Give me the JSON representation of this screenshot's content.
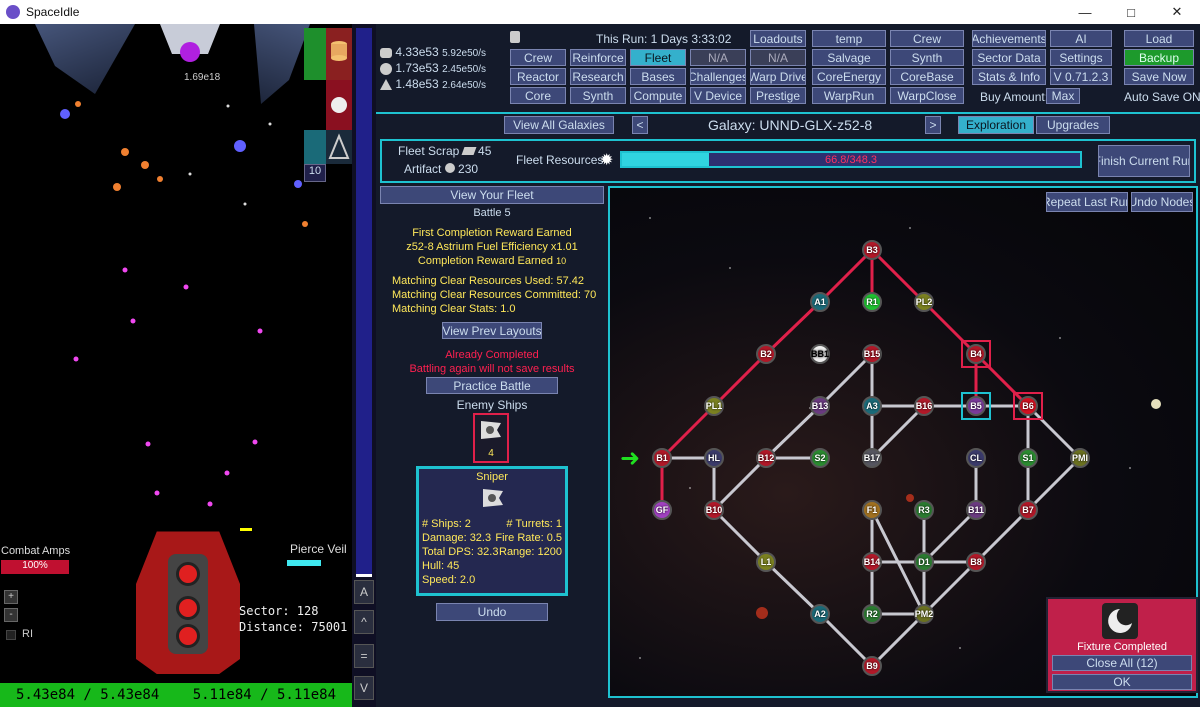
{
  "window": {
    "title": "SpaceIdle"
  },
  "game": {
    "hud_value": "1.69e18",
    "combat_amps_label": "Combat Amps",
    "combat_amps_value": "100%",
    "pierce_veil": "Pierce Veil",
    "sector": "Sector: 128",
    "distance": "Distance: 75001",
    "sidebar_count": "10",
    "hp_left": "5.43e84 / 5.43e84",
    "hp_right": "5.11e84 / 5.11e84",
    "plus": "+",
    "minus": "-",
    "ri": "RI"
  },
  "scroll": {
    "a": "A",
    "up": "^",
    "eq": "=",
    "down": "V"
  },
  "resources": [
    {
      "amount": "4.33e53",
      "rate": "5.92e50/s"
    },
    {
      "amount": "1.73e53",
      "rate": "2.45e50/s"
    },
    {
      "amount": "1.48e53",
      "rate": "2.64e50/s"
    }
  ],
  "this_run": "This Run: 1 Days 3:33:02",
  "nav": {
    "crew": "Crew",
    "reinforce": "Reinforce",
    "fleet": "Fleet",
    "na1": "N/A",
    "loadouts": "Loadouts",
    "temp": "temp",
    "crew2": "Crew",
    "achievements": "Achievements",
    "ai": "AI",
    "load": "Load",
    "reactor": "Reactor",
    "research": "Research",
    "bases": "Bases",
    "challenges": "Challenges",
    "na2": "N/A",
    "salvage": "Salvage",
    "synth2": "Synth",
    "sector_data": "Sector Data",
    "settings": "Settings",
    "backup": "Backup",
    "core": "Core",
    "synth": "Synth",
    "compute": "Compute",
    "vdevice": "V Device",
    "warpdrive": "Warp Drive",
    "coreenergy": "CoreEnergy",
    "corebase": "CoreBase",
    "stats": "Stats & Info",
    "version": "V 0.71.2.3",
    "savenow": "Save Now",
    "prestige": "Prestige",
    "warprun": "WarpRun",
    "warpclose": "WarpClose",
    "buy_amount": "Buy Amount:",
    "max": "Max",
    "autosave": "Auto Save ON"
  },
  "galaxy": {
    "view_all": "View All Galaxies",
    "prev": "<",
    "next": ">",
    "name": "Galaxy: UNND-GLX-z52-8",
    "exploration": "Exploration",
    "upgrades": "Upgrades"
  },
  "fleet": {
    "scrap_label": "Fleet Scrap",
    "scrap_value": "45",
    "artifact_label": "Artifact",
    "artifact_value": "230",
    "resources_label": "Fleet Resources",
    "resources_bar": "66.8/348.3",
    "resources_fill": 0.19,
    "finish_run": "Finish Current Run"
  },
  "battle": {
    "view_fleet": "View Your Fleet",
    "title": "Battle 5",
    "first_completion": "First Completion Reward Earned",
    "reward": "z52-8 Astrium Fuel Efficiency x1.01",
    "completion_reward": "Completion Reward Earned",
    "completion_value": "10",
    "used": "Matching Clear Resources Used: 57.42",
    "committed": "Matching Clear Resources Committed: 70",
    "stats": "Matching Clear Stats: 1.0",
    "view_prev": "View Prev Layouts",
    "already": "Already Completed",
    "battling": "Battling again will not save results",
    "practice": "Practice Battle",
    "enemy_ships": "Enemy Ships",
    "enemy_count": "4",
    "undo": "Undo"
  },
  "enemy": {
    "name": "Sniper",
    "ships": "# Ships: 2",
    "turrets": "# Turrets: 1",
    "damage": "Damage: 32.3",
    "fire_rate": "Fire Rate: 0.5",
    "dps": "Total DPS: 32.3",
    "range": "Range: 1200",
    "hull": "Hull: 45",
    "speed": "Speed: 2.0"
  },
  "map": {
    "repeat": "Repeat Last Run",
    "undo_nodes": "Undo Nodes",
    "nodes": {
      "B3": "B3",
      "A1": "A1",
      "R1": "R1",
      "PL2": "PL2",
      "B2": "B2",
      "BB1": "BB1",
      "B15": "B15",
      "B4": "B4",
      "PL1": "PL1",
      "B13": "B13",
      "A3": "A3",
      "B16": "B16",
      "B5": "B5",
      "B6": "B6",
      "B1": "B1",
      "HL": "HL",
      "B12": "B12",
      "S2": "S2",
      "B17": "B17",
      "CL": "CL",
      "S1": "S1",
      "PMI": "PMI",
      "GF": "GF",
      "B10": "B10",
      "F1": "F1",
      "R3": "R3",
      "B11": "B11",
      "B7": "B7",
      "L1": "L1",
      "B14": "B14",
      "D1": "D1",
      "B8": "B8",
      "A2": "A2",
      "R2": "R2",
      "PM2": "PM2",
      "B9": "B9"
    }
  },
  "popup": {
    "fixture": "Fixture Completed",
    "close_all": "Close All (12)",
    "ok": "OK"
  },
  "colors": {
    "accent": "#1ec2d0",
    "path": "#e0204a",
    "button": "#3d4878"
  }
}
